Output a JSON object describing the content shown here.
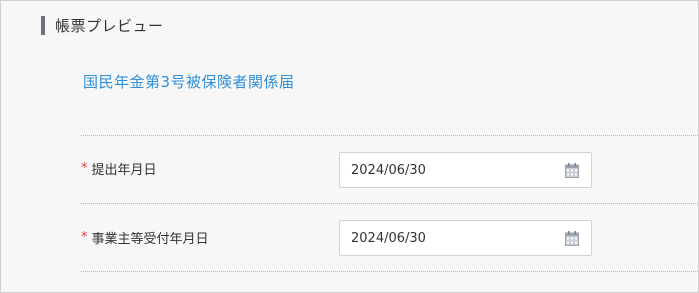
{
  "section": {
    "title": "帳票プレビュー"
  },
  "form": {
    "link_label": "国民年金第3号被保険者関係届"
  },
  "fields": [
    {
      "required_mark": "*",
      "label": "提出年月日",
      "value": "2024/06/30",
      "icon": "calendar-icon"
    },
    {
      "required_mark": "*",
      "label": "事業主等受付年月日",
      "value": "2024/06/30",
      "icon": "calendar-icon"
    }
  ],
  "colors": {
    "link": "#2f8fd8",
    "required": "#e0453c",
    "section_bar": "#6b6f7f",
    "text": "#333333"
  }
}
